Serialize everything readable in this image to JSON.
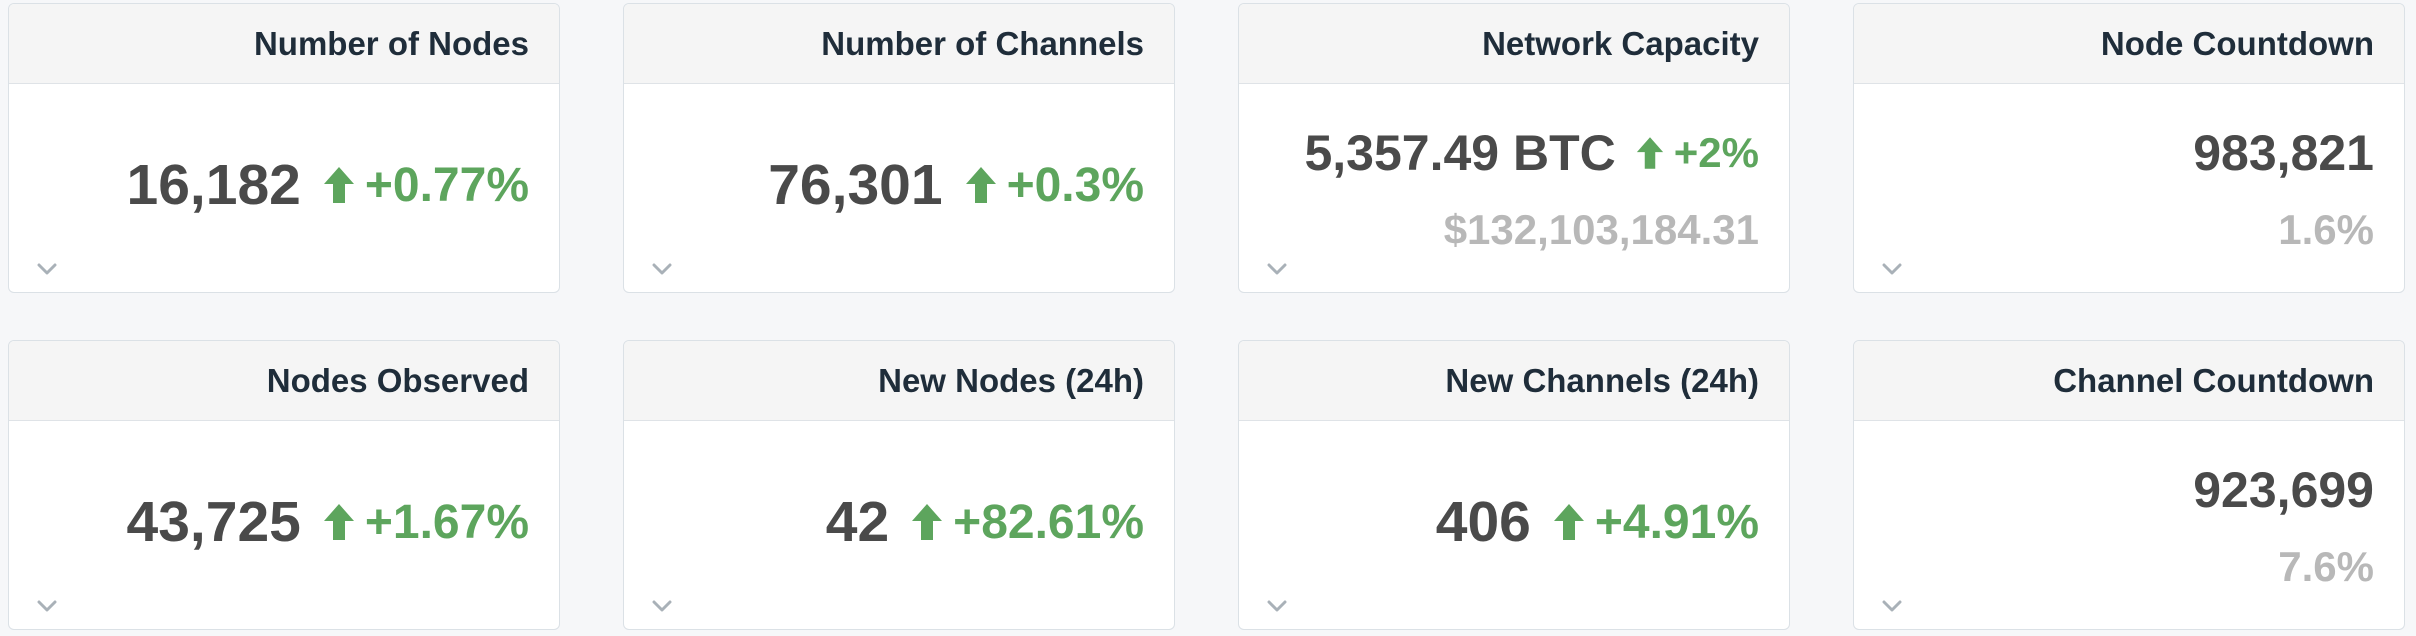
{
  "cards": [
    {
      "title": "Number of Nodes",
      "value": "16,182",
      "delta": "+0.77%",
      "delta_direction": "up"
    },
    {
      "title": "Number of Channels",
      "value": "76,301",
      "delta": "+0.3%",
      "delta_direction": "up"
    },
    {
      "title": "Network Capacity",
      "value": "5,357.49 BTC",
      "delta": "+2%",
      "delta_direction": "up",
      "sub": "$132,103,184.31"
    },
    {
      "title": "Node Countdown",
      "value": "983,821",
      "sub": "1.6%"
    },
    {
      "title": "Nodes Observed",
      "value": "43,725",
      "delta": "+1.67%",
      "delta_direction": "up"
    },
    {
      "title": "New Nodes (24h)",
      "value": "42",
      "delta": "+82.61%",
      "delta_direction": "up"
    },
    {
      "title": "New Channels (24h)",
      "value": "406",
      "delta": "+4.91%",
      "delta_direction": "up"
    },
    {
      "title": "Channel Countdown",
      "value": "923,699",
      "sub": "7.6%"
    }
  ],
  "colors": {
    "positive": "#5da55d",
    "value": "#4a4a4a",
    "muted": "#b8b8b8",
    "title": "#1f2d3a"
  },
  "icons": {
    "delta": "arrow-up-icon",
    "expand": "chevron-down-icon"
  }
}
